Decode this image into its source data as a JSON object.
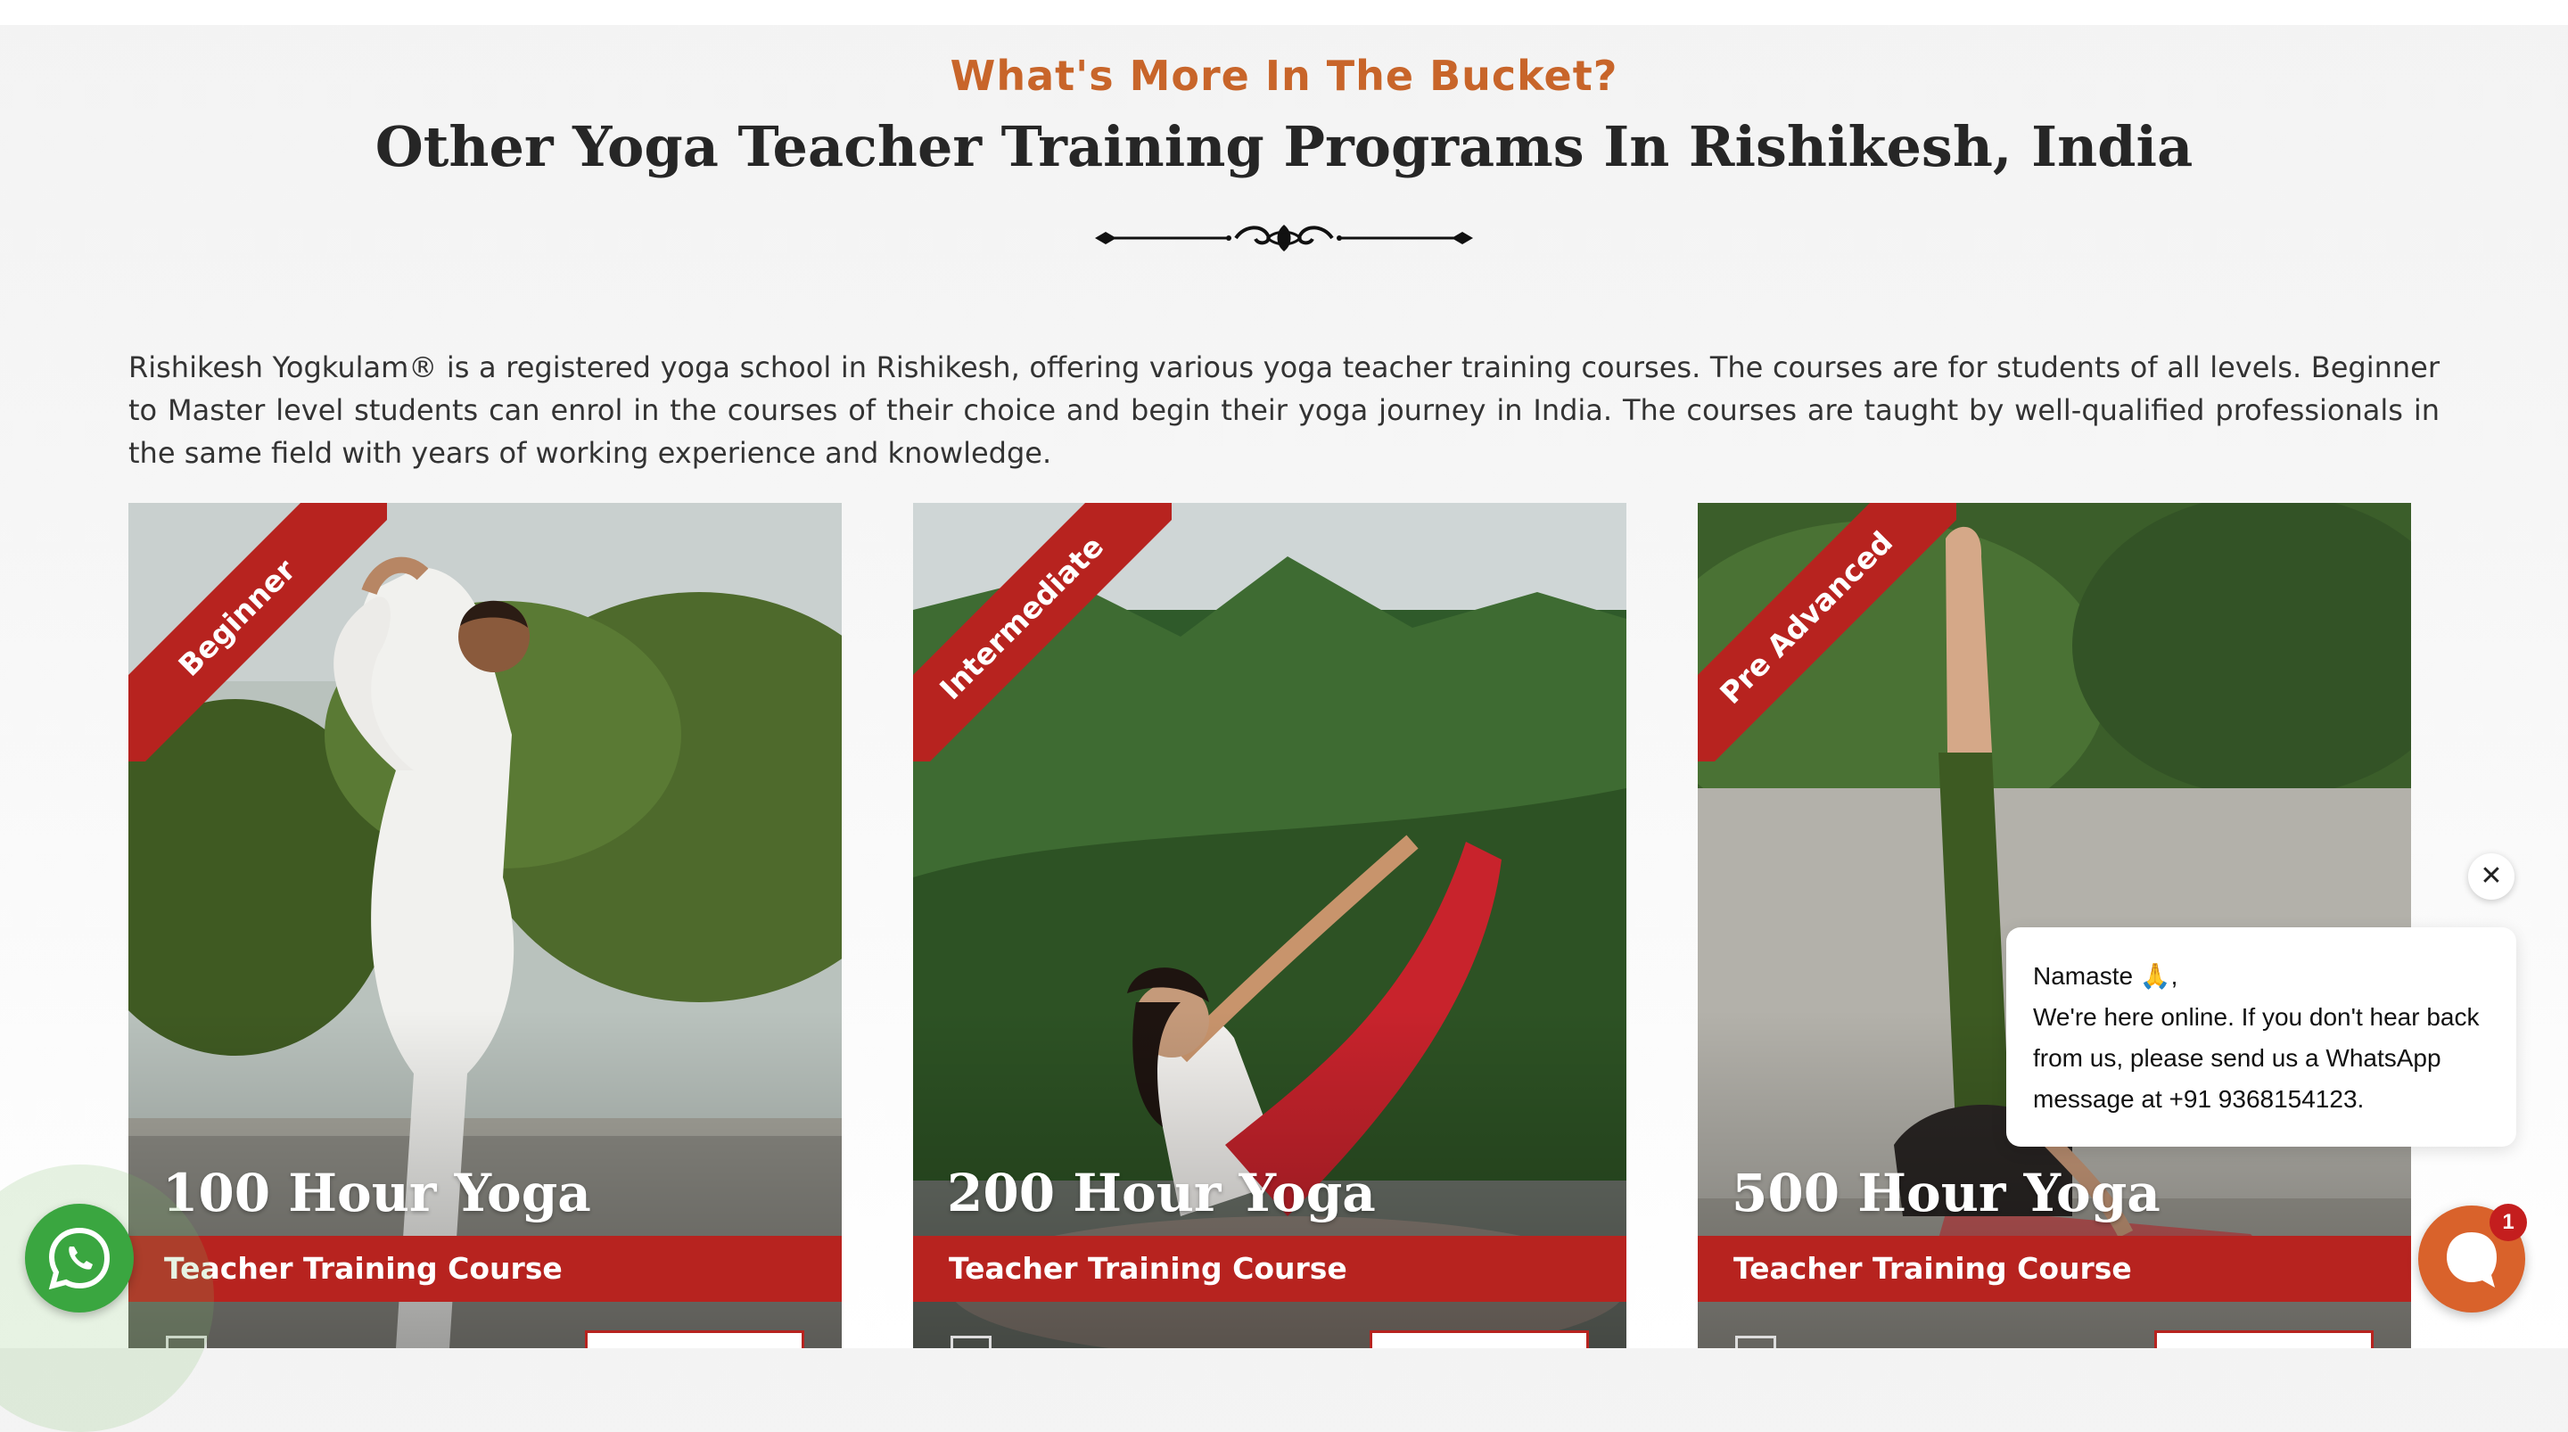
{
  "section": {
    "kicker": "What's More In The Bucket?",
    "heading": "Other Yoga Teacher Training Programs In Rishikesh, India",
    "intro": "Rishikesh Yogkulam® is a registered yoga school in Rishikesh, offering various yoga teacher training courses. The courses are for students of all levels. Beginner to Master level students can enrol in the courses of their choice and begin their yoga journey in India. The courses are taught by well-qualified professionals in the same field with years of working experience and knowledge."
  },
  "cards": [
    {
      "level": "Beginner",
      "title": "100 Hour Yoga",
      "subtitle": "Teacher Training Course"
    },
    {
      "level": "Intermediate",
      "title": "200 Hour Yoga",
      "subtitle": "Teacher Training Course"
    },
    {
      "level": "Pre Advanced",
      "title": "500 Hour Yoga",
      "subtitle": "Teacher Training Course"
    }
  ],
  "chat": {
    "close_symbol": "✕",
    "lines": [
      "Namaste 🙏,",
      "We're here online. If you don't hear back",
      "from us, please send us a WhatsApp",
      "message at +91 9368154123."
    ],
    "badge_count": "1",
    "icons": {
      "launcher": "chat-icon",
      "whatsapp": "whatsapp-icon"
    }
  },
  "colors": {
    "accent": "#c8652a",
    "ribbon": "#b7231f",
    "whatsapp": "#3aa640",
    "chat": "#d9622b"
  }
}
